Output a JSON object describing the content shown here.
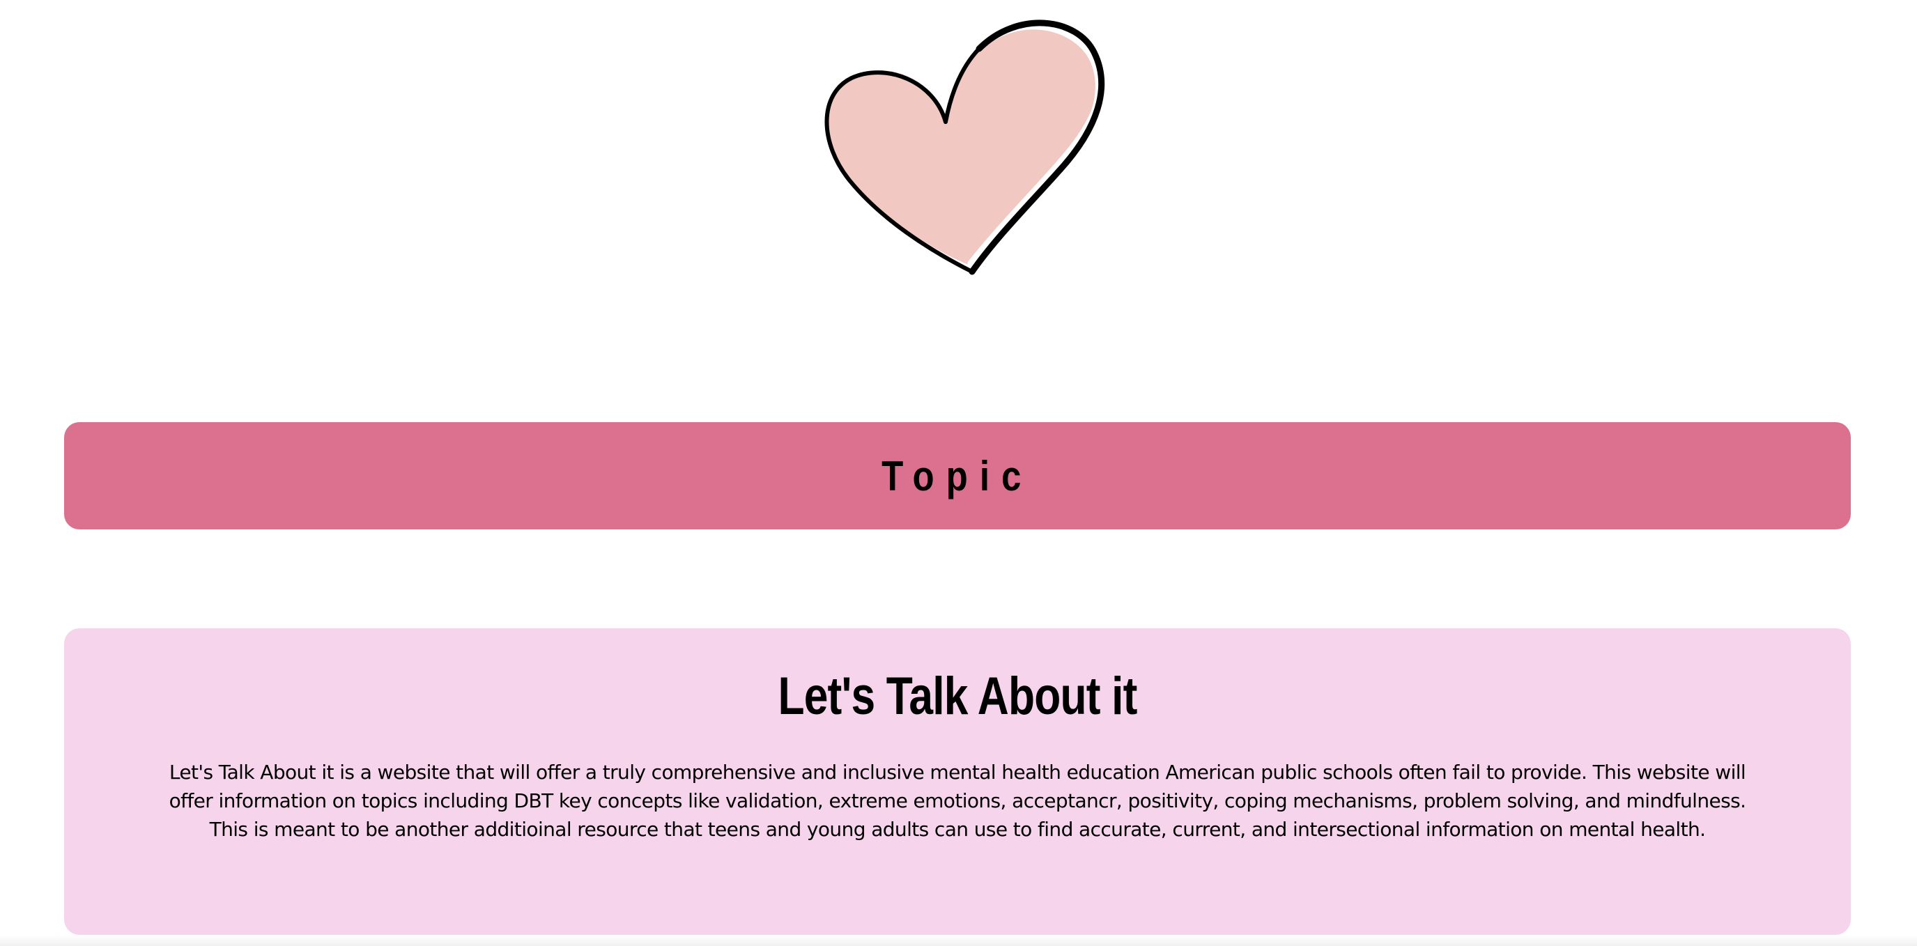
{
  "hero": {
    "icon": "heart-icon",
    "colors": {
      "heart_fill": "#f1c9c2",
      "heart_outline": "#000000"
    }
  },
  "topic_bar": {
    "label": "Topic",
    "background": "#dc718f"
  },
  "about": {
    "title": "Let's Talk About it",
    "body": "Let's Talk About it is a website that will offer a truly comprehensive and inclusive mental health education American public schools often fail to provide. This website will offer information on topics including DBT key concepts like validation, extreme emotions, acceptancr, positivity, coping mechanisms, problem solving, and mindfulness. This is meant to be another additioinal resource that teens and young adults can use to find accurate, current, and intersectional information on mental health.",
    "background": "#f6d5ec"
  }
}
